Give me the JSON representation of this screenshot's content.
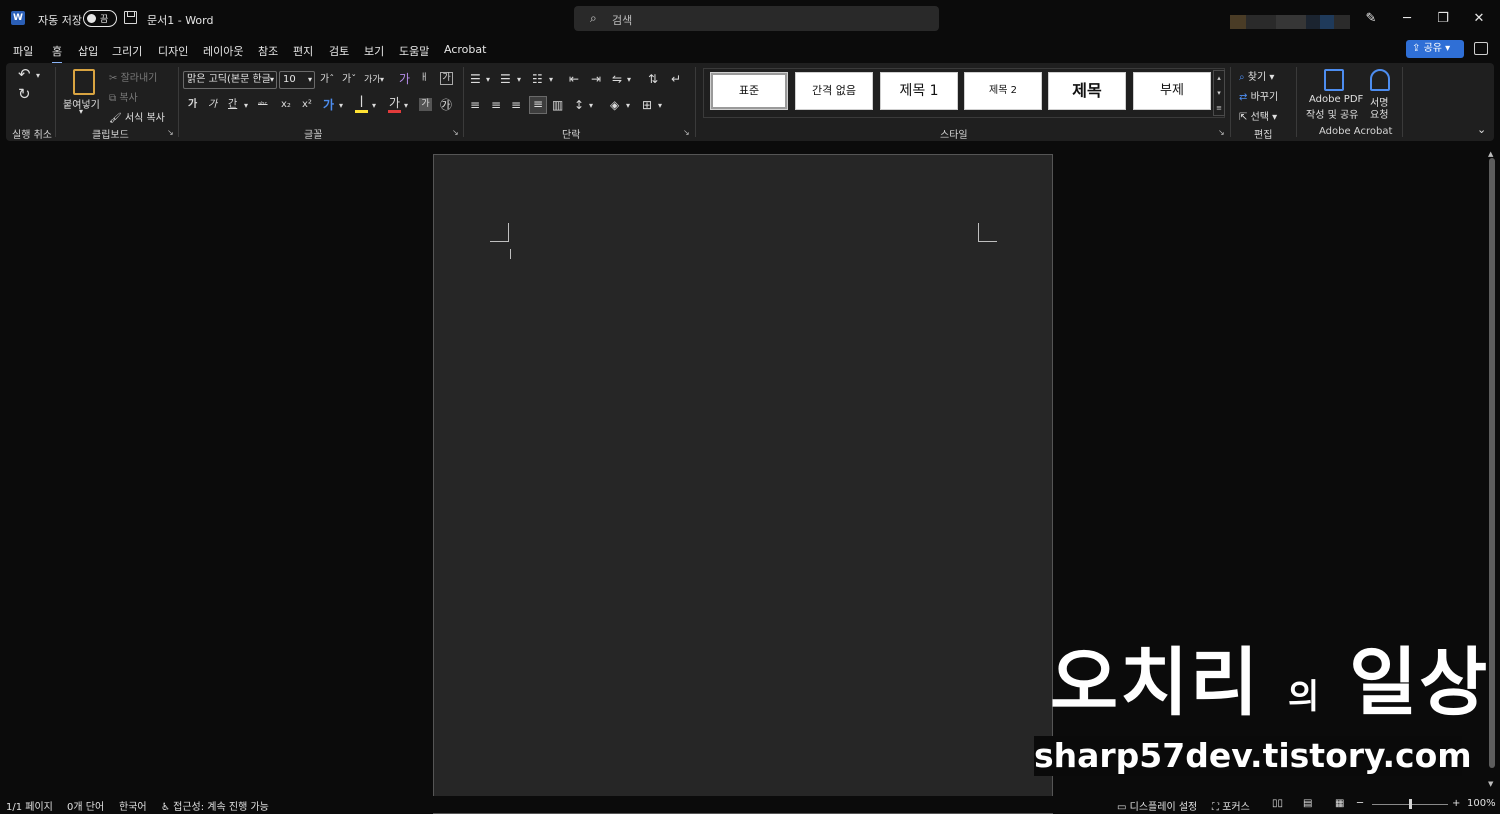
{
  "titlebar": {
    "app_icon": "W",
    "autosave_label": "자동 저장",
    "autosave_state": "끔",
    "doc_title": "문서1  -  Word",
    "search_placeholder": "검색",
    "search_icon": "⌕",
    "pen_icon": "✎",
    "minimize": "─",
    "restore": "❐",
    "close": "✕"
  },
  "menu": {
    "tabs": [
      "파일",
      "홈",
      "삽입",
      "그리기",
      "디자인",
      "레이아웃",
      "참조",
      "편지",
      "검토",
      "보기",
      "도움말",
      "Acrobat"
    ],
    "active_tab": "홈",
    "share_label": "공유"
  },
  "ribbon": {
    "undo": {
      "undo_icon": "↶",
      "redo_icon": "↻",
      "label": "실행 취소"
    },
    "clipboard": {
      "paste": "붙여넣기",
      "cut": "잘라내기",
      "copy": "복사",
      "format_painter": "서식 복사",
      "label": "클립보드"
    },
    "font": {
      "font_name": "맑은 고딕(본문 한글",
      "font_size": "10",
      "grow": "가ˆ",
      "shrink": "가ˇ",
      "case": "가가",
      "clear": "가",
      "phonetic": "ㅐ",
      "border": "가",
      "bold": "가",
      "italic": "가",
      "underline": "간",
      "strike": "ᵃᵇᶜ",
      "subscript": "x₂",
      "superscript": "x²",
      "effects": "가",
      "highlight": "ꟾ",
      "color": "가",
      "shade": "가",
      "enclose": "㉮",
      "label": "글꼴"
    },
    "paragraph": {
      "label": "단락"
    },
    "styles": {
      "items": [
        "표준",
        "간격 없음",
        "제목 1",
        "제목 2",
        "제목",
        "부제"
      ],
      "label": "스타일"
    },
    "editing": {
      "find": "찾기",
      "replace": "바꾸기",
      "select": "선택",
      "label": "편집"
    },
    "acrobat": {
      "create_pdf_1": "Adobe PDF",
      "create_pdf_2": "작성 및 공유",
      "sign_1": "서명",
      "sign_2": "요청",
      "label": "Adobe Acrobat"
    }
  },
  "watermark": {
    "title_part1": "오치리",
    "title_small": "의",
    "title_part2": "일상",
    "url": "sharp57dev.tistory.com"
  },
  "statusbar": {
    "page": "1/1 페이지",
    "words": "0개 단어",
    "language": "한국어",
    "accessibility": "접근성: 계속 진행 가능",
    "display_settings": "디스플레이 설정",
    "focus": "포커스",
    "zoom_out": "─",
    "zoom_in": "+",
    "zoom": "100%"
  }
}
